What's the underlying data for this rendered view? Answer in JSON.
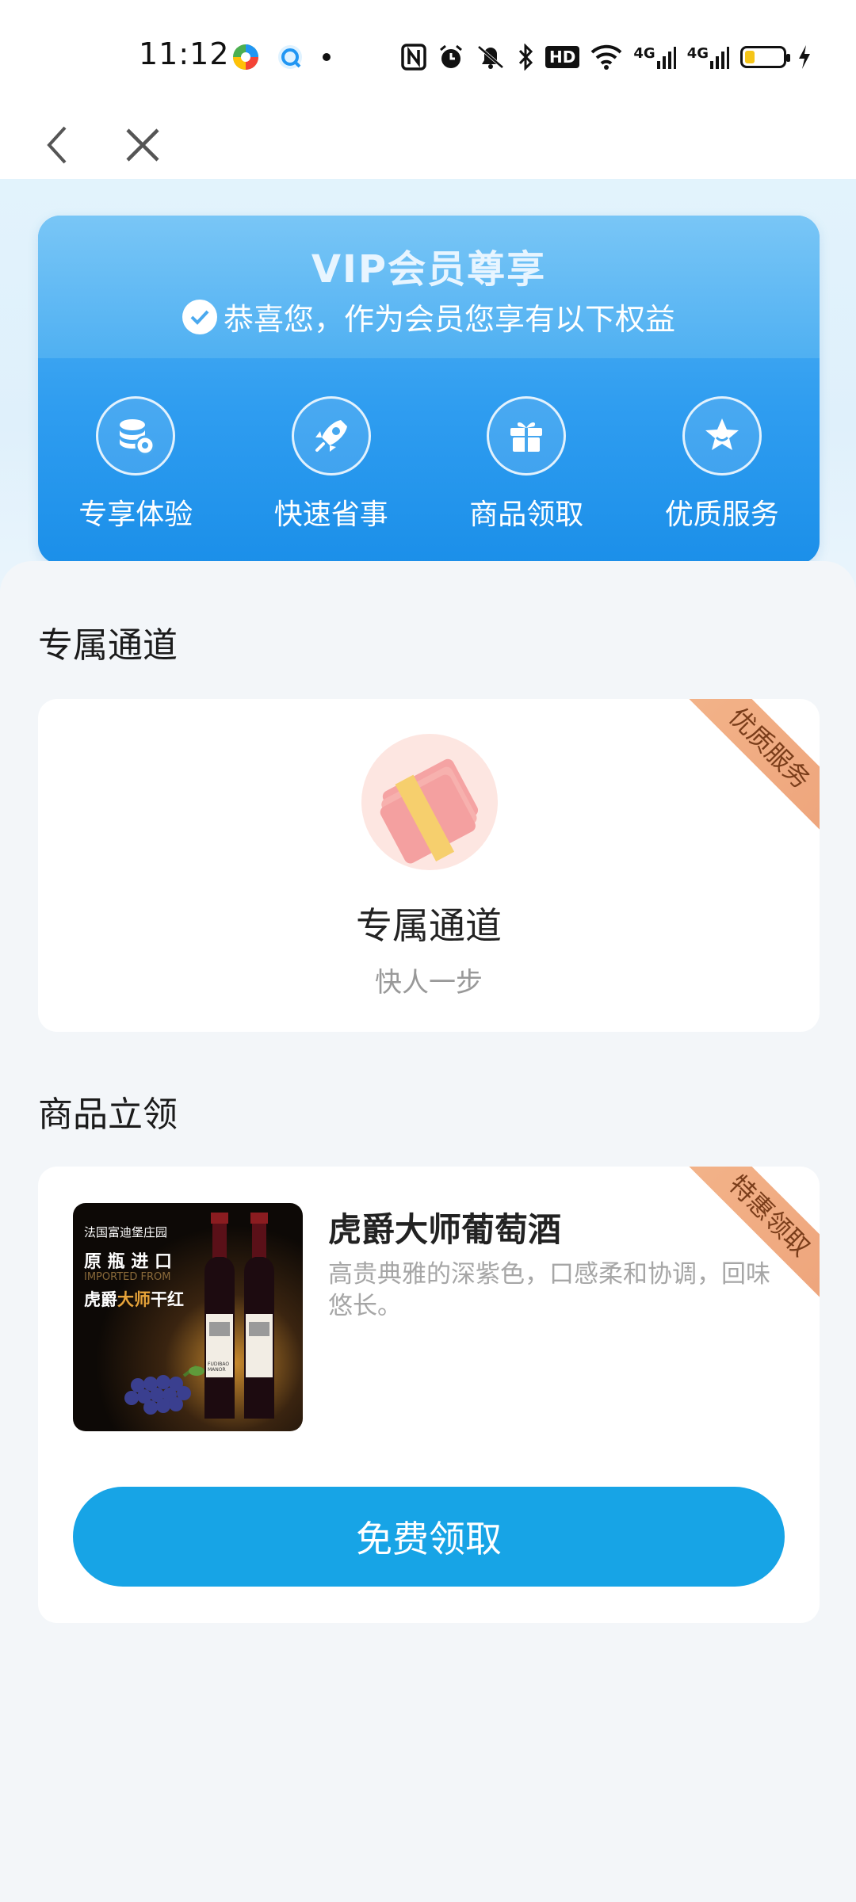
{
  "status_bar": {
    "time": "11:12",
    "network_1": "4G",
    "network_2": "4G",
    "hd": "HD",
    "battery_level": 0.25
  },
  "nav": {
    "back_icon": "chevron-left-icon",
    "close_icon": "close-icon"
  },
  "vip": {
    "title": "VIP会员尊享",
    "subtitle": "恭喜您，作为会员您享有以下权益",
    "benefits": [
      {
        "label": "专享体验",
        "icon": "coins-icon"
      },
      {
        "label": "快速省事",
        "icon": "rocket-icon"
      },
      {
        "label": "商品领取",
        "icon": "gift-icon"
      },
      {
        "label": "优质服务",
        "icon": "star-icon"
      }
    ]
  },
  "exclusive": {
    "section_title": "专属通道",
    "ribbon": "优质服务",
    "title": "专属通道",
    "subtitle": "快人一步"
  },
  "product": {
    "section_title": "商品立领",
    "ribbon": "特惠领取",
    "name": "虎爵大师葡萄酒",
    "description": "高贵典雅的深紫色，口感柔和协调，回味悠长。",
    "image_text": {
      "line1": "法国富迪堡庄园",
      "line2": "原 瓶 进 口",
      "line3": "IMPORTED FROM",
      "line4_a": "虎爵",
      "line4_b": "大师",
      "line4_c": "干红",
      "label": "FUDIBAO MANOR"
    },
    "button_label": "免费领取"
  },
  "colors": {
    "accent": "#17a4e6",
    "vip_blue": "#2f9df0",
    "ribbon": "#f0ab80"
  }
}
